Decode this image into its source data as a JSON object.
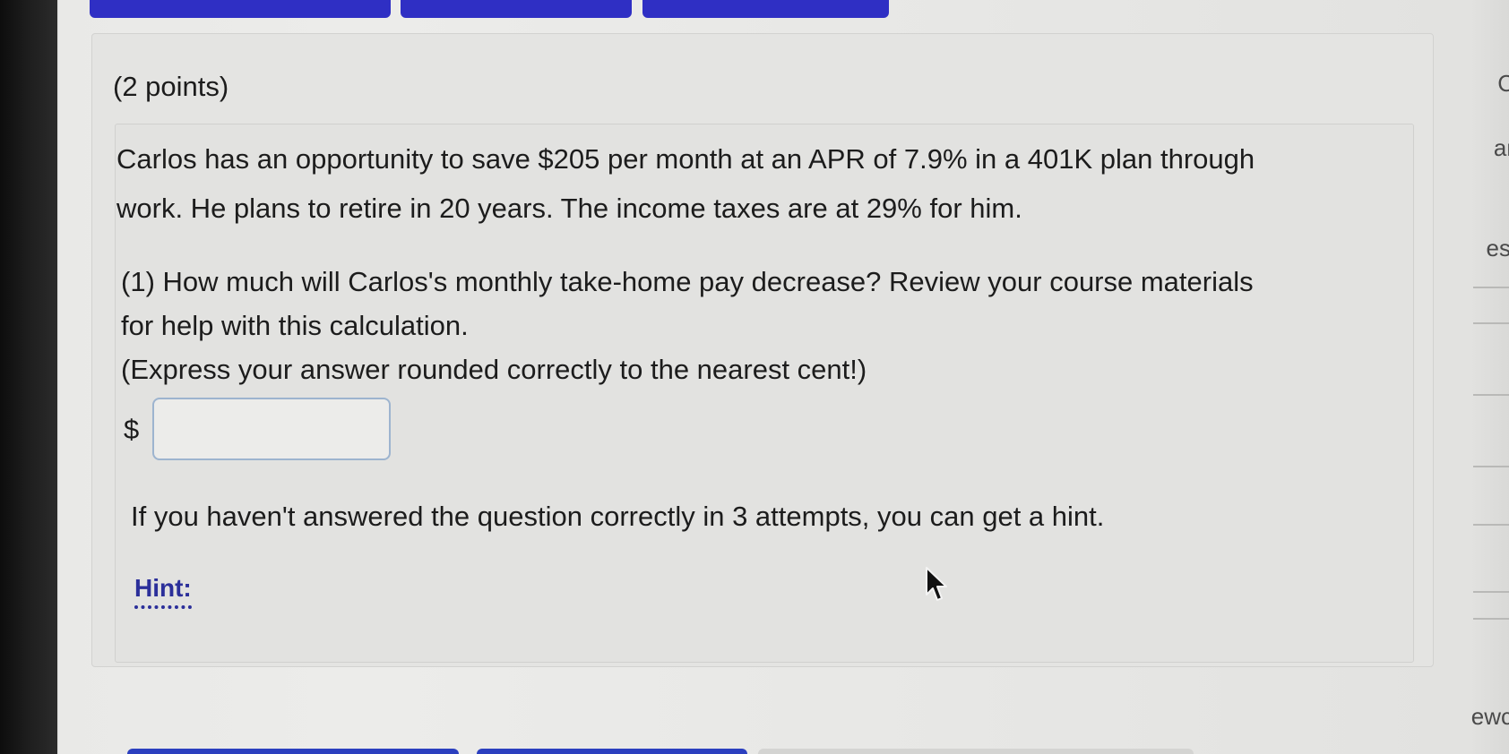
{
  "question": {
    "points": "(2 points)",
    "problem_line1": "Carlos has an opportunity to save $205 per month at an APR of 7.9% in a 401K plan through",
    "problem_line2": "work. He plans to retire in 20 years. The income taxes are at 29% for him.",
    "part1_line1": "(1) How much will Carlos's monthly take-home pay decrease? Review your course materials",
    "part1_line2": "for help with this calculation.",
    "part1_line3": "(Express your answer rounded correctly to the nearest cent!)",
    "currency_symbol": "$",
    "answer_value": "",
    "hint_note": "If you haven't answered the question correctly in 3 attempts, you can get a hint.",
    "hint_label": "Hint:"
  },
  "right_edge_fragments": {
    "f1": "C",
    "f2": "ar",
    "f3": "es",
    "f4": "ewc"
  },
  "colors": {
    "top_buttons": "#2f2fc4",
    "hint_link": "#2b2f9a",
    "input_border": "#9db4cf"
  }
}
